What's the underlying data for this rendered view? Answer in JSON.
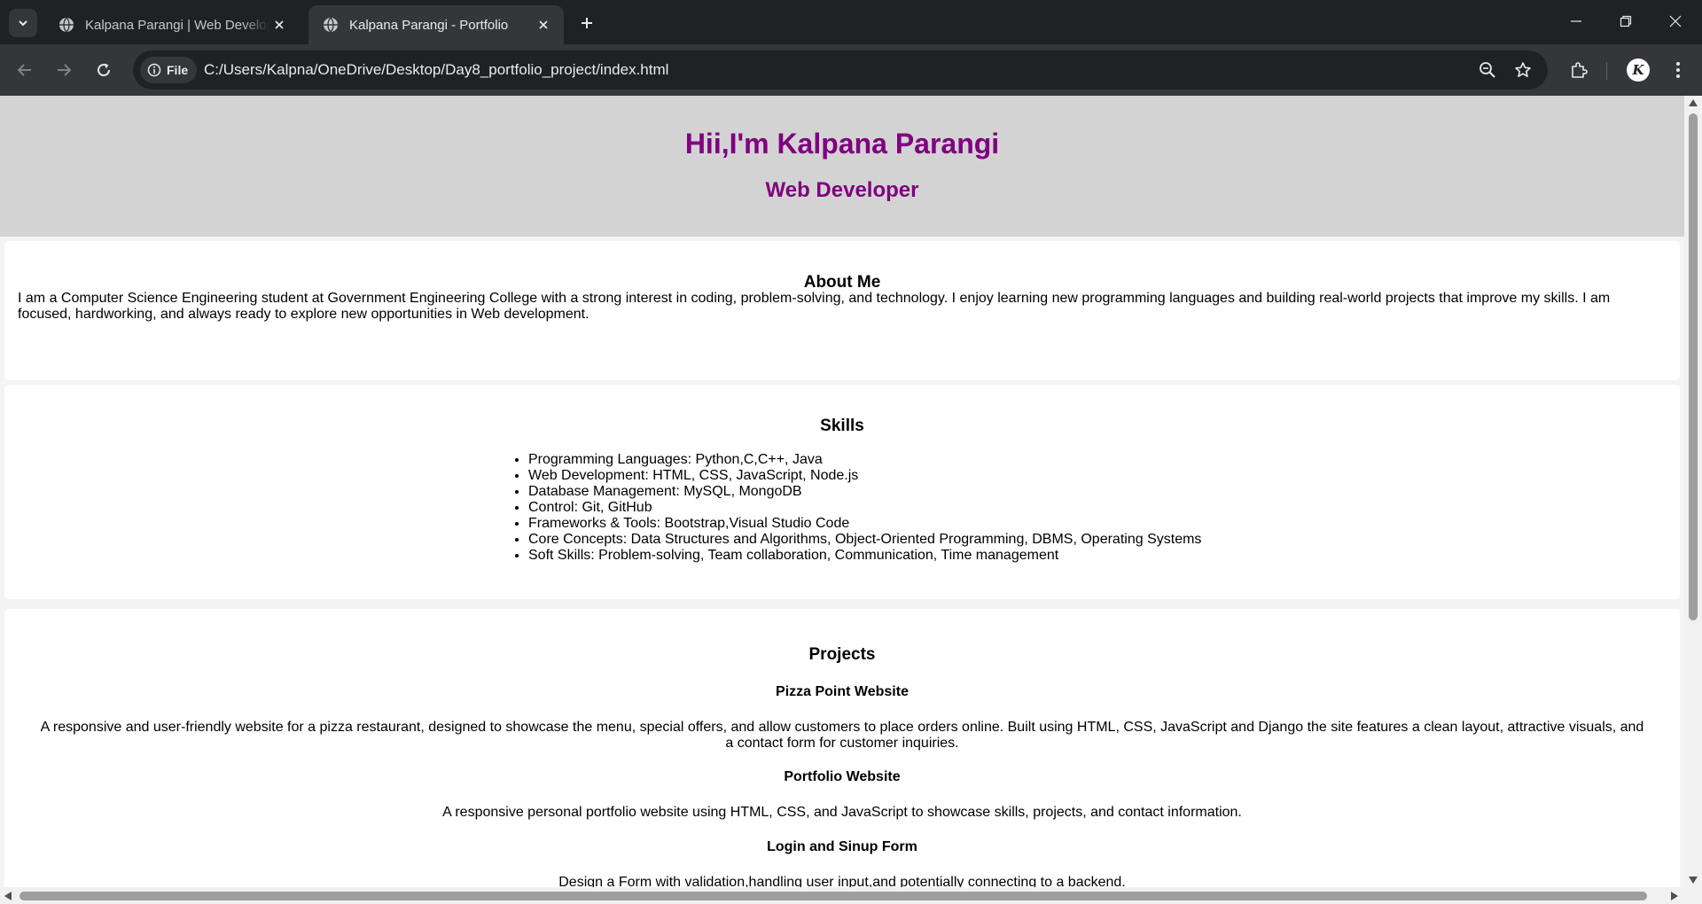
{
  "browser": {
    "tabs": [
      {
        "title": "Kalpana Parangi | Web Developer",
        "active": false
      },
      {
        "title": "Kalpana Parangi - Portfolio",
        "active": true
      }
    ],
    "address_bar": {
      "scheme_chip": "File",
      "url": "C:/Users/Kalpna/OneDrive/Desktop/Day8_portfolio_project/index.html"
    },
    "profile_initial": "K"
  },
  "page": {
    "header": {
      "title": "Hii,I'm Kalpana Parangi",
      "subtitle": "Web Developer"
    },
    "about": {
      "heading": "About Me",
      "text": "I am a Computer Science Engineering student at Government Engineering College with a strong interest in coding, problem-solving, and technology. I enjoy learning new programming languages and building real-world projects that improve my skills. I am focused, hardworking, and always ready to explore new opportunities in Web development."
    },
    "skills": {
      "heading": "Skills",
      "items": [
        "Programming Languages: Python,C,C++, Java",
        "Web Development: HTML, CSS, JavaScript, Node.js",
        "Database Management: MySQL, MongoDB",
        "Control: Git, GitHub",
        "Frameworks & Tools: Bootstrap,Visual Studio Code",
        "Core Concepts: Data Structures and Algorithms, Object-Oriented Programming, DBMS, Operating Systems",
        "Soft Skills: Problem-solving, Team collaboration, Communication, Time management"
      ]
    },
    "projects": {
      "heading": "Projects",
      "items": [
        {
          "name": "Pizza Point Website",
          "description": "A responsive and user-friendly website for a pizza restaurant, designed to showcase the menu, special offers, and allow customers to place orders online. Built using HTML, CSS, JavaScript and Django the site features a clean layout, attractive visuals, and a contact form for customer inquiries."
        },
        {
          "name": "Portfolio Website",
          "description": "A responsive personal portfolio website using HTML, CSS, and JavaScript to showcase skills, projects, and contact information."
        },
        {
          "name": "Login and Sinup Form",
          "description": "Design a Form with validation,handling user input,and potentially connecting to a backend."
        }
      ]
    }
  },
  "colors": {
    "header_bg": "#d3d3d3",
    "heading_purple": "#800080",
    "chrome_dark": "#202124",
    "chrome_toolbar": "#35363a"
  },
  "icons": {
    "tab_search": "chevron-down-icon",
    "favicon": "globe-icon",
    "tab_close": "close-icon",
    "new_tab": "plus-icon",
    "minimize": "minimize-icon",
    "restore": "restore-icon",
    "close_window": "close-icon",
    "back": "back-arrow-icon",
    "forward": "forward-arrow-icon",
    "reload": "reload-icon",
    "info": "info-icon",
    "zoom": "zoom-out-icon",
    "bookmark": "star-icon",
    "extensions": "puzzle-icon",
    "menu": "kebab-menu-icon"
  }
}
